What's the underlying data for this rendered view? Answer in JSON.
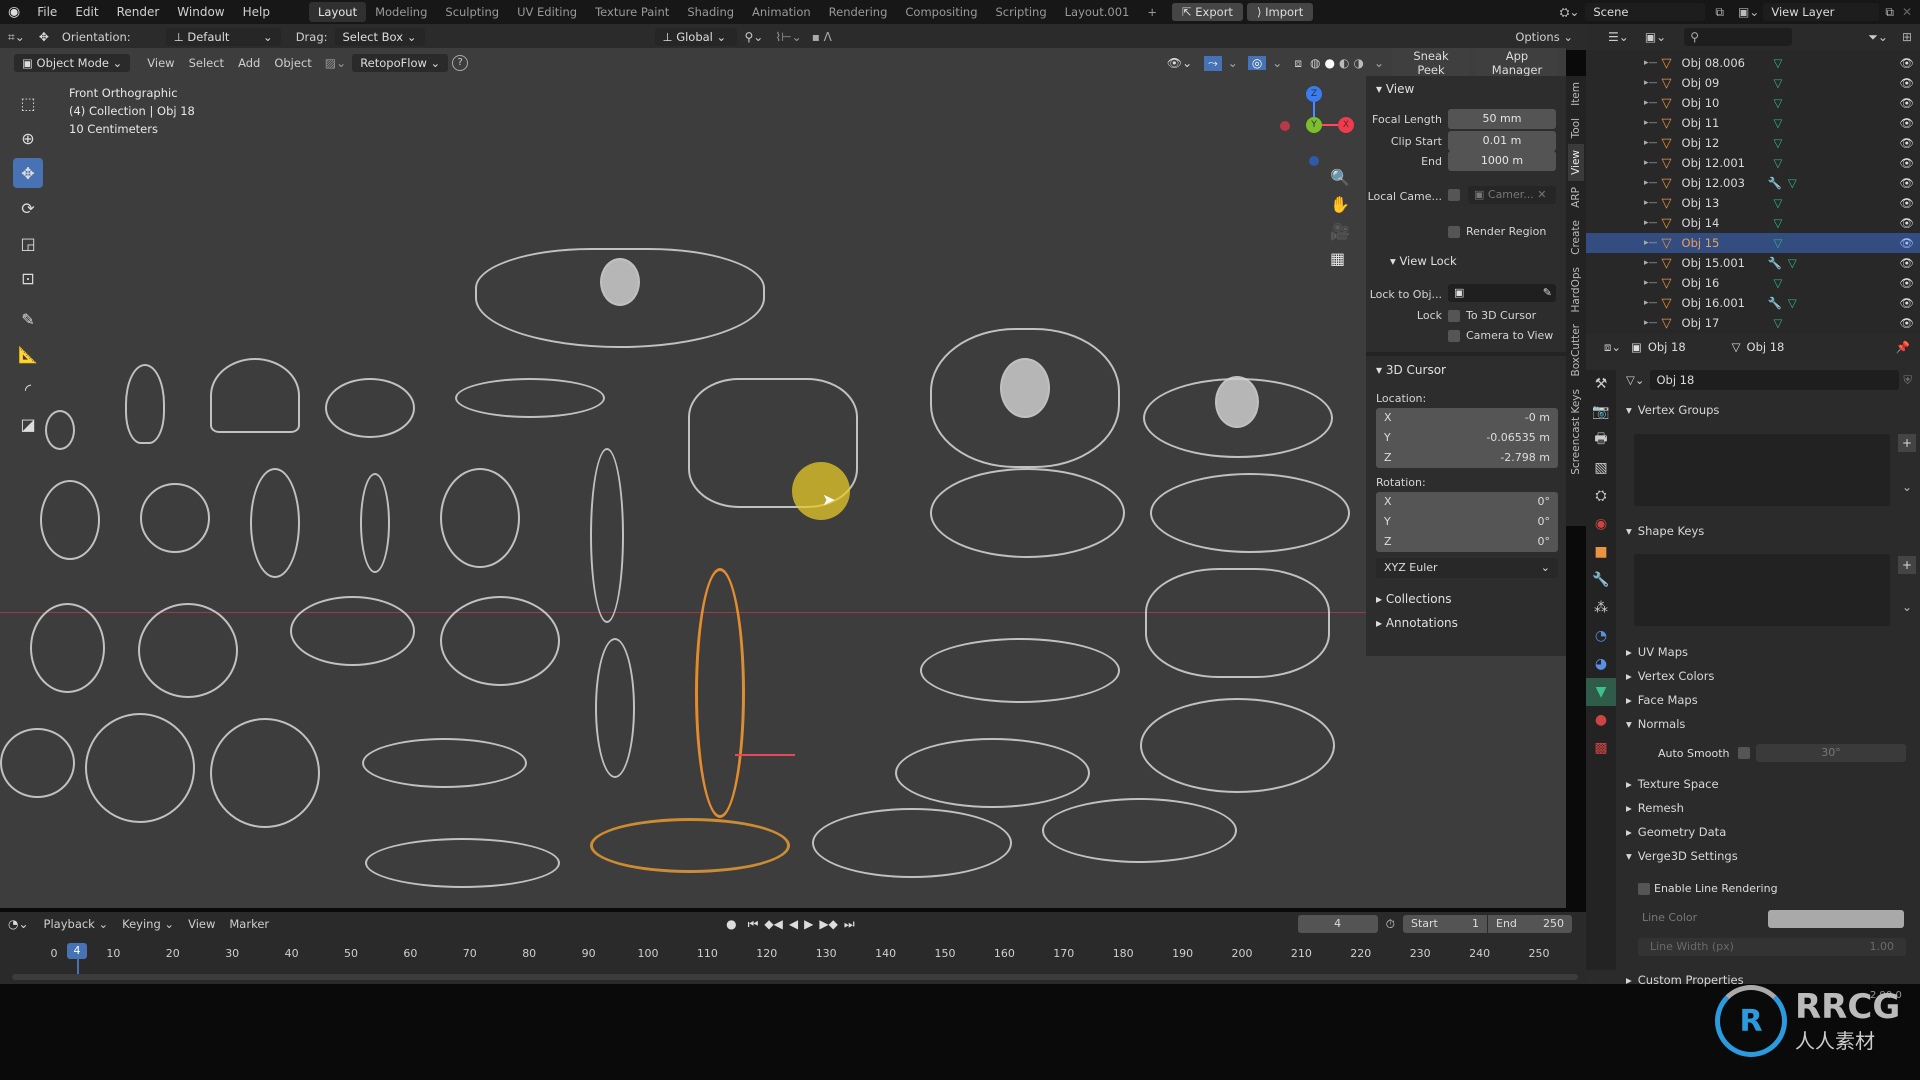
{
  "topbar": {
    "menus": [
      "File",
      "Edit",
      "Render",
      "Window",
      "Help"
    ],
    "workspaces": [
      "Layout",
      "Modeling",
      "Sculpting",
      "UV Editing",
      "Texture Paint",
      "Shading",
      "Animation",
      "Rendering",
      "Compositing",
      "Scripting",
      "Layout.001"
    ],
    "active_workspace": "Layout",
    "add_workspace": "+",
    "export_label": "Export",
    "import_label": "Import",
    "scene_label": "Scene",
    "view_layer_label": "View Layer"
  },
  "tool_header": {
    "orientation_label": "Orientation:",
    "orientation_value": "Default",
    "drag_label": "Drag:",
    "drag_value": "Select Box",
    "transform_orientation": "Global",
    "options_label": "Options"
  },
  "viewport_header": {
    "mode": "Object Mode",
    "menus": [
      "View",
      "Select",
      "Add",
      "Object"
    ],
    "retopoflow": "RetopoFlow",
    "help_icon": "?",
    "sneak_peek": "Sneak Peek",
    "app_manager": "App Manager"
  },
  "viewport_overlay": {
    "view_name": "Front Orthographic",
    "collection_info": "(4) Collection | Obj 18",
    "scale": "10 Centimeters"
  },
  "gizmo": {
    "x": "X",
    "y": "Y",
    "z": "Z"
  },
  "npanel": {
    "view_section": "View",
    "focal_length_label": "Focal Length",
    "focal_length_value": "50 mm",
    "clip_start_label": "Clip Start",
    "clip_start_value": "0.01 m",
    "clip_end_label": "End",
    "clip_end_value": "1000 m",
    "local_camera_label": "Local Came...",
    "local_camera_value": "Camer...",
    "render_region_label": "Render Region",
    "view_lock_section": "View Lock",
    "lock_to_object_label": "Lock to Obj...",
    "lock_label": "Lock",
    "to_3d_cursor_label": "To 3D Cursor",
    "camera_to_view_label": "Camera to View",
    "cursor_section": "3D Cursor",
    "location_label": "Location:",
    "location": [
      {
        "axis": "X",
        "value": "-0 m"
      },
      {
        "axis": "Y",
        "value": "-0.06535 m"
      },
      {
        "axis": "Z",
        "value": "-2.798 m"
      }
    ],
    "rotation_label": "Rotation:",
    "rotation": [
      {
        "axis": "X",
        "value": "0°"
      },
      {
        "axis": "Y",
        "value": "0°"
      },
      {
        "axis": "Z",
        "value": "0°"
      }
    ],
    "rotation_mode": "XYZ Euler",
    "collections_section": "Collections",
    "annotations_section": "Annotations",
    "tabs": [
      "Item",
      "Tool",
      "View",
      "ARP",
      "Create",
      "HardOps",
      "BoxCutter",
      "Screencast Keys"
    ],
    "active_tab": "View"
  },
  "outliner": {
    "items": [
      {
        "name": "Obj 08.006",
        "modifier": false,
        "selected": false
      },
      {
        "name": "Obj 09",
        "modifier": false,
        "selected": false
      },
      {
        "name": "Obj 10",
        "modifier": false,
        "selected": false
      },
      {
        "name": "Obj 11",
        "modifier": false,
        "selected": false
      },
      {
        "name": "Obj 12",
        "modifier": false,
        "selected": false
      },
      {
        "name": "Obj 12.001",
        "modifier": false,
        "selected": false
      },
      {
        "name": "Obj 12.003",
        "modifier": true,
        "selected": false
      },
      {
        "name": "Obj 13",
        "modifier": false,
        "selected": false
      },
      {
        "name": "Obj 14",
        "modifier": false,
        "selected": false
      },
      {
        "name": "Obj 15",
        "modifier": false,
        "selected": true
      },
      {
        "name": "Obj 15.001",
        "modifier": true,
        "selected": false
      },
      {
        "name": "Obj 16",
        "modifier": false,
        "selected": false
      },
      {
        "name": "Obj 16.001",
        "modifier": true,
        "selected": false
      },
      {
        "name": "Obj 17",
        "modifier": false,
        "selected": false
      }
    ]
  },
  "properties": {
    "object_name": "Obj 18",
    "mesh_name": "Obj 18",
    "data_block": "Obj 18",
    "sections": {
      "vertex_groups": "Vertex Groups",
      "shape_keys": "Shape Keys",
      "uv_maps": "UV Maps",
      "vertex_colors": "Vertex Colors",
      "face_maps": "Face Maps",
      "normals": "Normals",
      "auto_smooth_label": "Auto Smooth",
      "auto_smooth_angle": "30°",
      "texture_space": "Texture Space",
      "remesh": "Remesh",
      "geometry_data": "Geometry Data",
      "verge3d": "Verge3D Settings",
      "enable_line_rendering": "Enable Line Rendering",
      "line_color_label": "Line Color",
      "line_width_label": "Line Width (px)",
      "line_width_value": "1.00",
      "custom_properties": "Custom Properties"
    }
  },
  "timeline": {
    "editor_menus": [
      "Playback",
      "Keying",
      "View",
      "Marker"
    ],
    "current_frame": "4",
    "start_label": "Start",
    "start_value": "1",
    "end_label": "End",
    "end_value": "250",
    "ticks": [
      "0",
      "10",
      "20",
      "30",
      "40",
      "50",
      "60",
      "70",
      "80",
      "90",
      "100",
      "110",
      "120",
      "130",
      "140",
      "150",
      "160",
      "170",
      "180",
      "190",
      "200",
      "210",
      "220",
      "230",
      "240",
      "250"
    ]
  },
  "status": {
    "version": "2.90.0"
  },
  "watermark": {
    "brand": "RRCG",
    "sub": "人人素材"
  }
}
